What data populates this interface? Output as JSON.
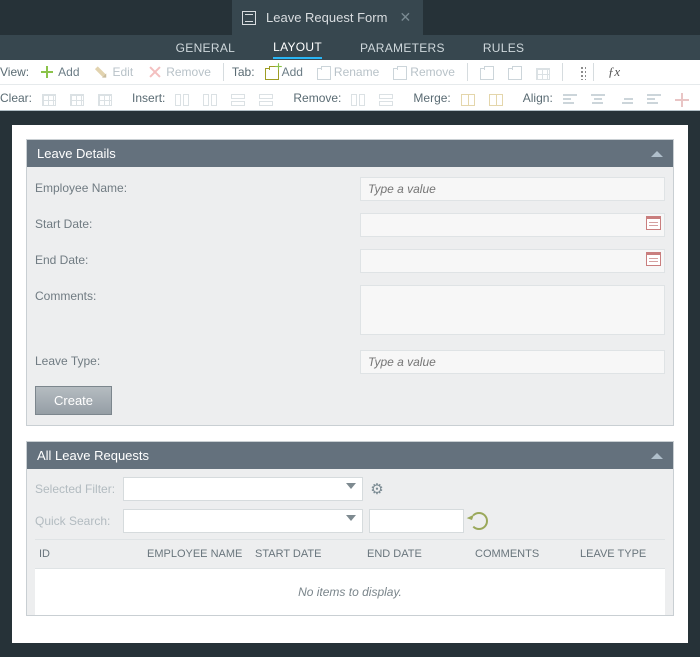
{
  "tab": {
    "title": "Leave Request Form"
  },
  "nav": {
    "general": "GENERAL",
    "layout": "LAYOUT",
    "parameters": "PARAMETERS",
    "rules": "RULES"
  },
  "toolbar": {
    "row1": {
      "view": "View:",
      "add": "Add",
      "edit": "Edit",
      "remove": "Remove",
      "tab": "Tab:",
      "add2": "Add",
      "rename": "Rename",
      "remove2": "Remove"
    },
    "row2": {
      "clear": "Clear:",
      "insert": "Insert:",
      "remove": "Remove:",
      "merge": "Merge:",
      "align": "Align:"
    }
  },
  "fx": "ƒx",
  "panel1": {
    "title": "Leave Details",
    "employee_label": "Employee Name:",
    "employee_ph": "Type a value",
    "start_label": "Start Date:",
    "end_label": "End Date:",
    "comments_label": "Comments:",
    "leavetype_label": "Leave Type:",
    "leavetype_ph": "Type a value",
    "create": "Create"
  },
  "panel2": {
    "title": "All Leave Requests",
    "selected_filter": "Selected Filter:",
    "quick_search": "Quick Search:",
    "cols": {
      "id": "ID",
      "emp": "EMPLOYEE NAME",
      "start": "START DATE",
      "end": "END DATE",
      "comments": "COMMENTS",
      "type": "LEAVE TYPE"
    },
    "empty": "No items to display."
  }
}
